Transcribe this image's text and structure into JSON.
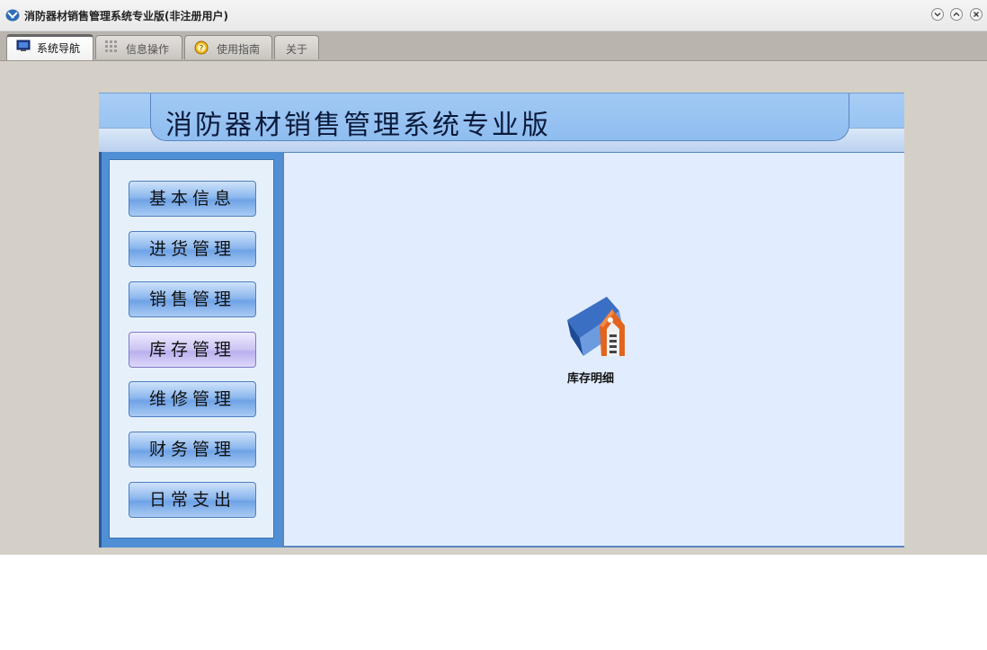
{
  "window": {
    "title": "消防器材销售管理系统专业版(非注册用户)"
  },
  "tabs": [
    {
      "label": "系统导航",
      "icon": "monitor-icon",
      "active": true
    },
    {
      "label": "信息操作",
      "icon": "grid-icon",
      "active": false
    },
    {
      "label": "使用指南",
      "icon": "help-icon",
      "active": false
    },
    {
      "label": "关于",
      "icon": "",
      "active": false
    }
  ],
  "banner": {
    "title": "消防器材销售管理系统专业版"
  },
  "sidebar": {
    "items": [
      {
        "label": "基本信息"
      },
      {
        "label": "进货管理"
      },
      {
        "label": "销售管理"
      },
      {
        "label": "库存管理",
        "selected": true
      },
      {
        "label": "维修管理"
      },
      {
        "label": "财务管理"
      },
      {
        "label": "日常支出"
      }
    ]
  },
  "content": {
    "items": [
      {
        "label": "库存明细",
        "icon": "warehouse-icon"
      }
    ]
  },
  "colors": {
    "banner": "#8cbcf0",
    "sidebar": "#4f8fd5",
    "content_bg": "#e1edfe",
    "selected_item": "#cbc4f3"
  }
}
